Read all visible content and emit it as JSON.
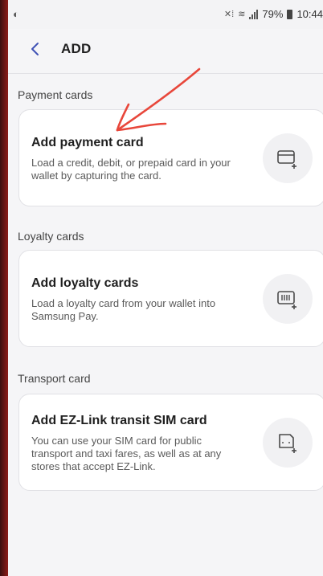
{
  "status_bar": {
    "left_icon": "notification-dot-icon",
    "battery_percent": "79%",
    "time": "10:44"
  },
  "app_bar": {
    "title": "ADD",
    "back_icon": "chevron-left-icon"
  },
  "sections": [
    {
      "label": "Payment cards",
      "card": {
        "title": "Add payment card",
        "description": "Load a credit, debit, or prepaid card in your wallet by capturing the card.",
        "icon": "card-add-icon"
      }
    },
    {
      "label": "Loyalty cards",
      "card": {
        "title": "Add loyalty cards",
        "description": "Load a loyalty card from your wallet into Samsung Pay.",
        "icon": "barcode-add-icon"
      }
    },
    {
      "label": "Transport card",
      "card": {
        "title": "Add EZ-Link transit SIM card",
        "description": "You can use your SIM card for public transport and taxi fares, as well as at any stores that accept EZ-Link.",
        "icon": "sim-card-add-icon"
      }
    }
  ],
  "colors": {
    "annotation": "#e8473b",
    "icon": "#4a4a4a",
    "accent": "#3f51b5"
  }
}
